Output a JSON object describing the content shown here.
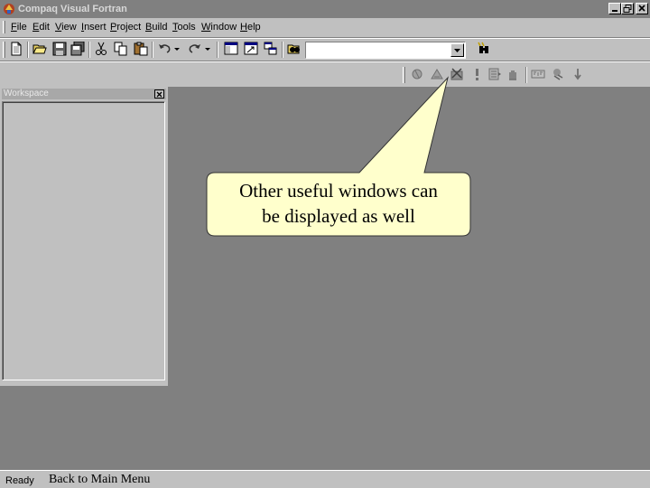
{
  "window": {
    "title": "Compaq Visual Fortran",
    "controls": [
      "minimize-icon",
      "restore-icon",
      "close-icon"
    ]
  },
  "menu": {
    "items": [
      {
        "label": "File"
      },
      {
        "label": "Edit"
      },
      {
        "label": "View"
      },
      {
        "label": "Insert"
      },
      {
        "label": "Project"
      },
      {
        "label": "Build"
      },
      {
        "label": "Tools"
      },
      {
        "label": "Window"
      },
      {
        "label": "Help"
      }
    ]
  },
  "standard_toolbar": {
    "buttons": [
      "new-file-icon",
      "open-folder-icon",
      "save-icon",
      "save-all-icon",
      "cut-icon",
      "copy-icon",
      "paste-icon",
      "undo-icon",
      "redo-icon",
      "workspace-icon",
      "output-icon",
      "window-list-icon",
      "find-in-files-icon"
    ],
    "find_combo_value": "",
    "search_button": "search-binoculars-icon"
  },
  "build_toolbar": {
    "buttons": [
      "compile-icon",
      "build-icon",
      "stop-build-icon",
      "execute-icon",
      "go-icon",
      "breakpoint-icon",
      "fortran-icon",
      "debug-icon",
      "step-icon"
    ]
  },
  "workspace": {
    "title": "Workspace"
  },
  "callout": {
    "line1": "Other useful windows can",
    "line2": "be displayed as well",
    "fill": "#ffffcc"
  },
  "status": {
    "text": "Ready",
    "back_link": "Back to Main Menu"
  }
}
